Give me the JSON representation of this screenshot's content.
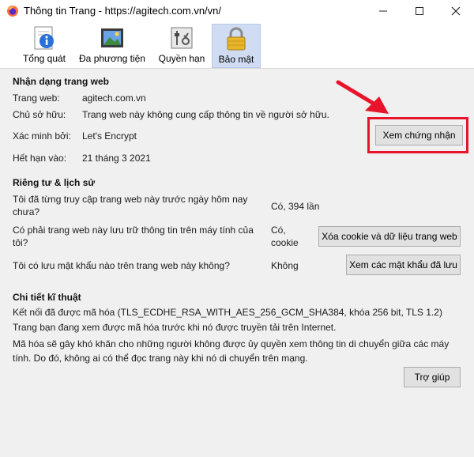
{
  "window": {
    "title": "Thông tin Trang - https://agitech.com.vn/vn/",
    "controls": {
      "minimize": "—",
      "maximize": "☐",
      "close": "✕"
    }
  },
  "tabs": [
    {
      "label": "Tổng quát",
      "icon": "info-icon",
      "active": false
    },
    {
      "label": "Đa phương tiện",
      "icon": "media-icon",
      "active": false
    },
    {
      "label": "Quyền hạn",
      "icon": "permissions-icon",
      "active": false
    },
    {
      "label": "Bảo mật",
      "icon": "lock-icon",
      "active": true
    }
  ],
  "identity": {
    "heading": "Nhận dạng trang web",
    "website_label": "Trang web:",
    "website_value": "agitech.com.vn",
    "owner_label": "Chủ sở hữu:",
    "owner_value": "Trang web này không cung cấp thông tin về người sở hữu.",
    "verified_label": "Xác minh bởi:",
    "verified_value": "Let's Encrypt",
    "expires_label": "Hết hạn vào:",
    "expires_value": "21 tháng 3 2021",
    "view_cert_button": "Xem chứng nhận"
  },
  "privacy": {
    "heading": "Riêng tư & lịch sử",
    "visited_question": "Tôi đã từng truy cập trang web này trước ngày hôm nay chưa?",
    "visited_answer": "Có, 394 lần",
    "cookies_question": "Có phải trang web này lưu trữ thông tin trên máy tính của tôi?",
    "cookies_answer": "Có, cookie",
    "clear_cookies_button": "Xóa cookie và dữ liệu trang web",
    "passwords_question": "Tôi có lưu mật khẩu nào trên trang web này không?",
    "passwords_answer": "Không",
    "view_passwords_button": "Xem các mật khẩu đã lưu"
  },
  "technical": {
    "heading": "Chi tiết kĩ thuật",
    "connection": "Kết nối đã được mã hóa (TLS_ECDHE_RSA_WITH_AES_256_GCM_SHA384, khóa 256 bit, TLS 1.2)",
    "encrypted_note": "Trang bạn đang xem được mã hóa trước khi nó được truyền tải trên Internet.",
    "encryption_explain": "Mã hóa sẽ gây khó khăn cho những người không được ủy quyền xem thông tin di chuyển giữa các máy tính. Do đó, không ai có thể đọc trang này khi nó di chuyển trên mạng.",
    "help_button": "Trợ giúp"
  },
  "colors": {
    "annotation_red": "#e8142b",
    "active_tab": "#cfdcf2",
    "background": "#f0f0f0"
  }
}
